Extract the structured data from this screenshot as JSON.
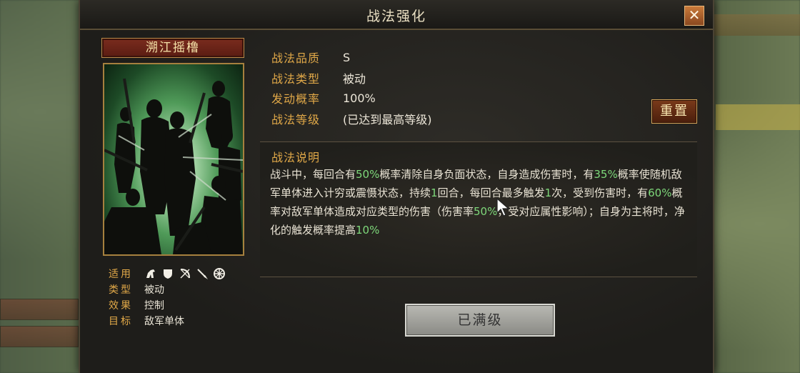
{
  "dialog": {
    "title": "战法强化",
    "close_label": "✕"
  },
  "skill": {
    "name": "溯江摇橹",
    "quality_label": "战法品质",
    "quality_value": "S",
    "type_label": "战法类型",
    "type_value": "被动",
    "prob_label": "发动概率",
    "prob_value": "100%",
    "level_label": "战法等级",
    "level_value": "(已达到最高等级)"
  },
  "reset_label": "重置",
  "card_info": {
    "apply_label": "适用",
    "type_label": "类型",
    "type_value": "被动",
    "effect_label": "效果",
    "effect_value": "控制",
    "target_label": "目标",
    "target_value": "敌军单体",
    "suit_icons": [
      "cavalry-icon",
      "shield-icon",
      "bow-icon",
      "spear-icon",
      "wheel-icon"
    ]
  },
  "description": {
    "title": "战法说明",
    "segments": [
      {
        "t": "战斗中，每回合有"
      },
      {
        "t": "50%",
        "hl": true
      },
      {
        "t": "概率清除自身负面状态，自身造成伤害时，有"
      },
      {
        "t": "35%",
        "hl": true
      },
      {
        "t": "概率使随机敌军单体进入计穷或震慑状态，持续"
      },
      {
        "t": "1",
        "hl": true
      },
      {
        "t": "回合，每回合最多触发"
      },
      {
        "t": "1",
        "hl": true
      },
      {
        "t": "次，受到伤害时，有"
      },
      {
        "t": "60%",
        "hl": true
      },
      {
        "t": "概率对敌军单体造成对应类型的伤害（伤害率"
      },
      {
        "t": "50%",
        "hl": true
      },
      {
        "t": "，受对应属性影响）；自身为主将时，净化的触发概率提高"
      },
      {
        "t": "10%",
        "hl": true
      }
    ]
  },
  "maxed_label": "已满级",
  "colors": {
    "label_gold": "#e0a848",
    "highlight_green": "#7ed87a",
    "text_light": "#e9e3d4"
  }
}
